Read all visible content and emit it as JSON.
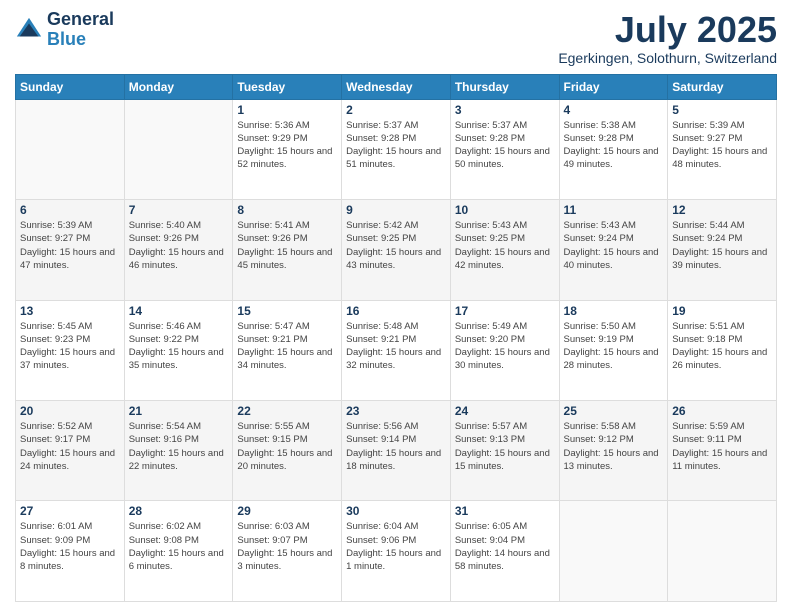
{
  "header": {
    "logo_line1": "General",
    "logo_line2": "Blue",
    "month": "July 2025",
    "location": "Egerkingen, Solothurn, Switzerland"
  },
  "days_of_week": [
    "Sunday",
    "Monday",
    "Tuesday",
    "Wednesday",
    "Thursday",
    "Friday",
    "Saturday"
  ],
  "weeks": [
    [
      {
        "day": "",
        "sunrise": "",
        "sunset": "",
        "daylight": "",
        "empty": true
      },
      {
        "day": "",
        "sunrise": "",
        "sunset": "",
        "daylight": "",
        "empty": true
      },
      {
        "day": "1",
        "sunrise": "Sunrise: 5:36 AM",
        "sunset": "Sunset: 9:29 PM",
        "daylight": "Daylight: 15 hours and 52 minutes."
      },
      {
        "day": "2",
        "sunrise": "Sunrise: 5:37 AM",
        "sunset": "Sunset: 9:28 PM",
        "daylight": "Daylight: 15 hours and 51 minutes."
      },
      {
        "day": "3",
        "sunrise": "Sunrise: 5:37 AM",
        "sunset": "Sunset: 9:28 PM",
        "daylight": "Daylight: 15 hours and 50 minutes."
      },
      {
        "day": "4",
        "sunrise": "Sunrise: 5:38 AM",
        "sunset": "Sunset: 9:28 PM",
        "daylight": "Daylight: 15 hours and 49 minutes."
      },
      {
        "day": "5",
        "sunrise": "Sunrise: 5:39 AM",
        "sunset": "Sunset: 9:27 PM",
        "daylight": "Daylight: 15 hours and 48 minutes."
      }
    ],
    [
      {
        "day": "6",
        "sunrise": "Sunrise: 5:39 AM",
        "sunset": "Sunset: 9:27 PM",
        "daylight": "Daylight: 15 hours and 47 minutes."
      },
      {
        "day": "7",
        "sunrise": "Sunrise: 5:40 AM",
        "sunset": "Sunset: 9:26 PM",
        "daylight": "Daylight: 15 hours and 46 minutes."
      },
      {
        "day": "8",
        "sunrise": "Sunrise: 5:41 AM",
        "sunset": "Sunset: 9:26 PM",
        "daylight": "Daylight: 15 hours and 45 minutes."
      },
      {
        "day": "9",
        "sunrise": "Sunrise: 5:42 AM",
        "sunset": "Sunset: 9:25 PM",
        "daylight": "Daylight: 15 hours and 43 minutes."
      },
      {
        "day": "10",
        "sunrise": "Sunrise: 5:43 AM",
        "sunset": "Sunset: 9:25 PM",
        "daylight": "Daylight: 15 hours and 42 minutes."
      },
      {
        "day": "11",
        "sunrise": "Sunrise: 5:43 AM",
        "sunset": "Sunset: 9:24 PM",
        "daylight": "Daylight: 15 hours and 40 minutes."
      },
      {
        "day": "12",
        "sunrise": "Sunrise: 5:44 AM",
        "sunset": "Sunset: 9:24 PM",
        "daylight": "Daylight: 15 hours and 39 minutes."
      }
    ],
    [
      {
        "day": "13",
        "sunrise": "Sunrise: 5:45 AM",
        "sunset": "Sunset: 9:23 PM",
        "daylight": "Daylight: 15 hours and 37 minutes."
      },
      {
        "day": "14",
        "sunrise": "Sunrise: 5:46 AM",
        "sunset": "Sunset: 9:22 PM",
        "daylight": "Daylight: 15 hours and 35 minutes."
      },
      {
        "day": "15",
        "sunrise": "Sunrise: 5:47 AM",
        "sunset": "Sunset: 9:21 PM",
        "daylight": "Daylight: 15 hours and 34 minutes."
      },
      {
        "day": "16",
        "sunrise": "Sunrise: 5:48 AM",
        "sunset": "Sunset: 9:21 PM",
        "daylight": "Daylight: 15 hours and 32 minutes."
      },
      {
        "day": "17",
        "sunrise": "Sunrise: 5:49 AM",
        "sunset": "Sunset: 9:20 PM",
        "daylight": "Daylight: 15 hours and 30 minutes."
      },
      {
        "day": "18",
        "sunrise": "Sunrise: 5:50 AM",
        "sunset": "Sunset: 9:19 PM",
        "daylight": "Daylight: 15 hours and 28 minutes."
      },
      {
        "day": "19",
        "sunrise": "Sunrise: 5:51 AM",
        "sunset": "Sunset: 9:18 PM",
        "daylight": "Daylight: 15 hours and 26 minutes."
      }
    ],
    [
      {
        "day": "20",
        "sunrise": "Sunrise: 5:52 AM",
        "sunset": "Sunset: 9:17 PM",
        "daylight": "Daylight: 15 hours and 24 minutes."
      },
      {
        "day": "21",
        "sunrise": "Sunrise: 5:54 AM",
        "sunset": "Sunset: 9:16 PM",
        "daylight": "Daylight: 15 hours and 22 minutes."
      },
      {
        "day": "22",
        "sunrise": "Sunrise: 5:55 AM",
        "sunset": "Sunset: 9:15 PM",
        "daylight": "Daylight: 15 hours and 20 minutes."
      },
      {
        "day": "23",
        "sunrise": "Sunrise: 5:56 AM",
        "sunset": "Sunset: 9:14 PM",
        "daylight": "Daylight: 15 hours and 18 minutes."
      },
      {
        "day": "24",
        "sunrise": "Sunrise: 5:57 AM",
        "sunset": "Sunset: 9:13 PM",
        "daylight": "Daylight: 15 hours and 15 minutes."
      },
      {
        "day": "25",
        "sunrise": "Sunrise: 5:58 AM",
        "sunset": "Sunset: 9:12 PM",
        "daylight": "Daylight: 15 hours and 13 minutes."
      },
      {
        "day": "26",
        "sunrise": "Sunrise: 5:59 AM",
        "sunset": "Sunset: 9:11 PM",
        "daylight": "Daylight: 15 hours and 11 minutes."
      }
    ],
    [
      {
        "day": "27",
        "sunrise": "Sunrise: 6:01 AM",
        "sunset": "Sunset: 9:09 PM",
        "daylight": "Daylight: 15 hours and 8 minutes."
      },
      {
        "day": "28",
        "sunrise": "Sunrise: 6:02 AM",
        "sunset": "Sunset: 9:08 PM",
        "daylight": "Daylight: 15 hours and 6 minutes."
      },
      {
        "day": "29",
        "sunrise": "Sunrise: 6:03 AM",
        "sunset": "Sunset: 9:07 PM",
        "daylight": "Daylight: 15 hours and 3 minutes."
      },
      {
        "day": "30",
        "sunrise": "Sunrise: 6:04 AM",
        "sunset": "Sunset: 9:06 PM",
        "daylight": "Daylight: 15 hours and 1 minute."
      },
      {
        "day": "31",
        "sunrise": "Sunrise: 6:05 AM",
        "sunset": "Sunset: 9:04 PM",
        "daylight": "Daylight: 14 hours and 58 minutes."
      },
      {
        "day": "",
        "sunrise": "",
        "sunset": "",
        "daylight": "",
        "empty": true
      },
      {
        "day": "",
        "sunrise": "",
        "sunset": "",
        "daylight": "",
        "empty": true
      }
    ]
  ]
}
